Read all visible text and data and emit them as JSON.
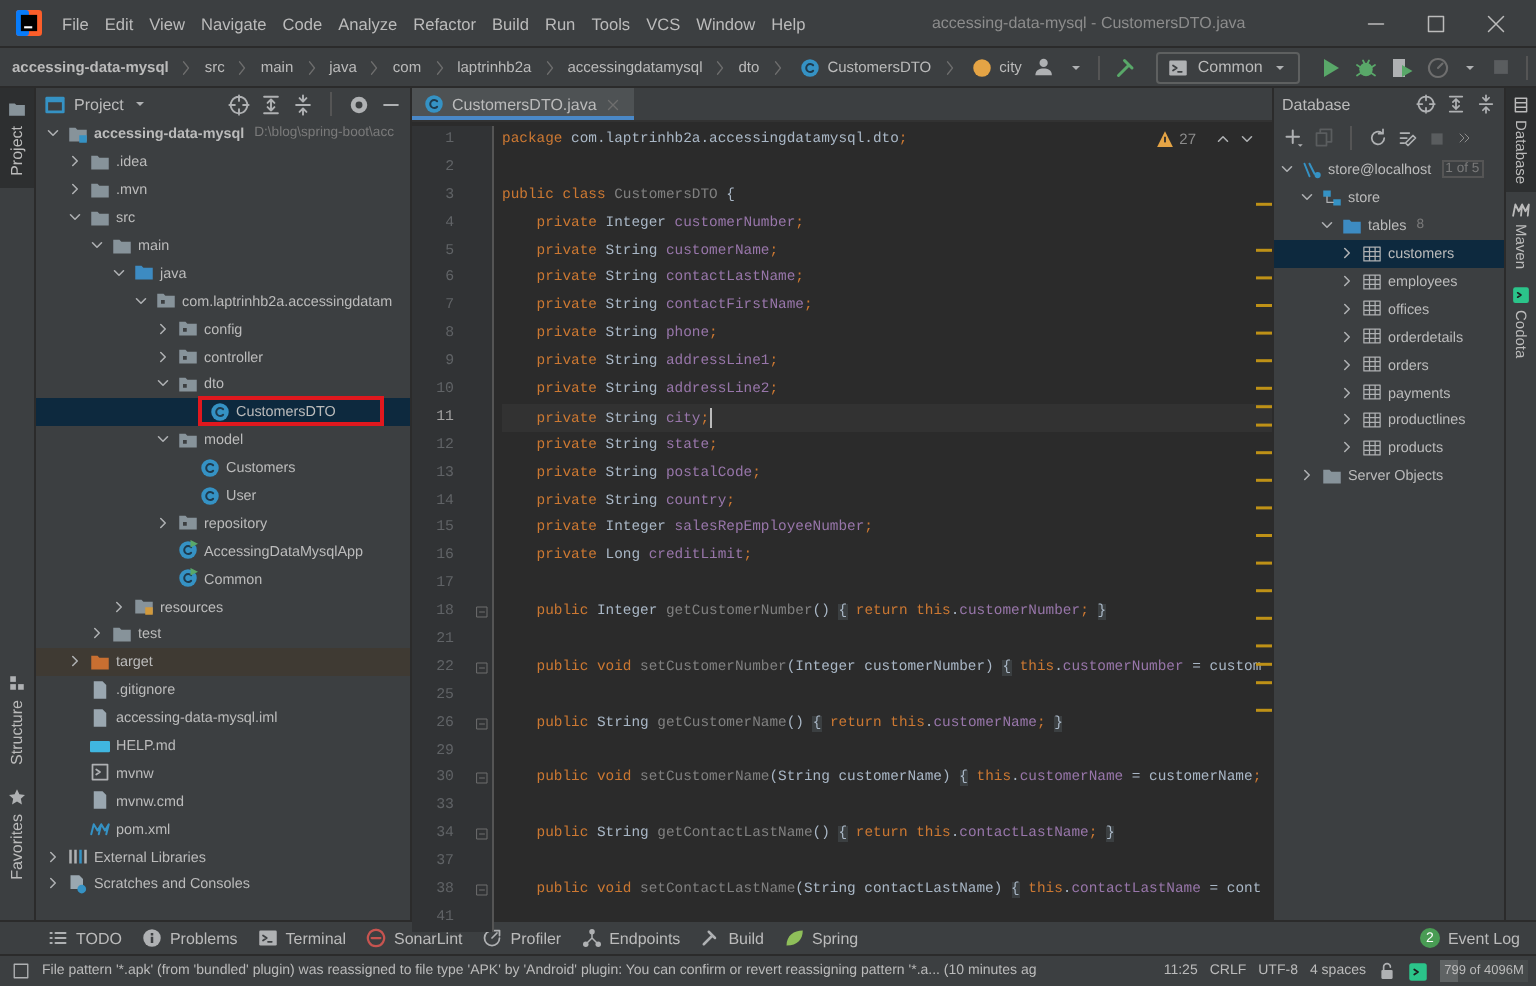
{
  "menu_bar": {
    "items": [
      "File",
      "Edit",
      "View",
      "Navigate",
      "Code",
      "Analyze",
      "Refactor",
      "Build",
      "Run",
      "Tools",
      "VCS",
      "Window",
      "Help"
    ],
    "title": "accessing-data-mysql - CustomersDTO.java"
  },
  "breadcrumbs": [
    {
      "label": "accessing-data-mysql",
      "kind": "project"
    },
    {
      "label": "src",
      "kind": "plain"
    },
    {
      "label": "main",
      "kind": "plain"
    },
    {
      "label": "java",
      "kind": "plain"
    },
    {
      "label": "com",
      "kind": "plain"
    },
    {
      "label": "laptrinhb2a",
      "kind": "plain"
    },
    {
      "label": "accessingdatamysql",
      "kind": "plain"
    },
    {
      "label": "dto",
      "kind": "plain"
    },
    {
      "label": "CustomersDTO",
      "kind": "class"
    },
    {
      "label": "city",
      "kind": "field"
    }
  ],
  "run_config": {
    "label": "Common"
  },
  "project_panel": {
    "title": "Project",
    "tree": [
      {
        "label": "accessing-data-mysql",
        "kind": "module",
        "note": "D:\\blog\\spring-boot\\acc",
        "expanded": true,
        "selected": false,
        "annotated": false,
        "children": [
          {
            "label": ".idea",
            "kind": "folder",
            "expanded": false,
            "selected": false,
            "annotated": false
          },
          {
            "label": ".mvn",
            "kind": "folder",
            "expanded": false,
            "selected": false,
            "annotated": false
          },
          {
            "label": "src",
            "kind": "folder",
            "expanded": true,
            "selected": false,
            "annotated": false,
            "children": [
              {
                "label": "main",
                "kind": "folder",
                "expanded": true,
                "selected": false,
                "annotated": false,
                "children": [
                  {
                    "label": "java",
                    "kind": "source",
                    "expanded": true,
                    "selected": false,
                    "annotated": false,
                    "children": [
                      {
                        "label": "com.laptrinhb2a.accessingdatam",
                        "kind": "package",
                        "expanded": true,
                        "selected": false,
                        "annotated": false,
                        "children": [
                          {
                            "label": "config",
                            "kind": "package",
                            "expanded": false,
                            "selected": false,
                            "annotated": false
                          },
                          {
                            "label": "controller",
                            "kind": "package",
                            "expanded": false,
                            "selected": false,
                            "annotated": false
                          },
                          {
                            "label": "dto",
                            "kind": "package",
                            "expanded": true,
                            "selected": false,
                            "annotated": false,
                            "children": [
                              {
                                "label": "CustomersDTO",
                                "kind": "class",
                                "selected": true,
                                "annotated": true
                              }
                            ]
                          },
                          {
                            "label": "model",
                            "kind": "package",
                            "expanded": true,
                            "selected": false,
                            "annotated": false,
                            "children": [
                              {
                                "label": "Customers",
                                "kind": "class",
                                "selected": false,
                                "annotated": false
                              },
                              {
                                "label": "User",
                                "kind": "class",
                                "selected": false,
                                "annotated": false
                              }
                            ]
                          },
                          {
                            "label": "repository",
                            "kind": "package",
                            "expanded": false,
                            "selected": false,
                            "annotated": false
                          },
                          {
                            "label": "AccessingDataMysqlApp",
                            "kind": "runnable",
                            "selected": false,
                            "annotated": false
                          },
                          {
                            "label": "Common",
                            "kind": "runnable",
                            "selected": false,
                            "annotated": false
                          }
                        ]
                      }
                    ]
                  },
                  {
                    "label": "resources",
                    "kind": "resources",
                    "expanded": false,
                    "selected": false,
                    "annotated": false
                  }
                ]
              },
              {
                "label": "test",
                "kind": "folder",
                "expanded": false,
                "selected": false,
                "annotated": false
              }
            ]
          },
          {
            "label": "target",
            "kind": "excluded",
            "expanded": false,
            "selected": false,
            "annotated": false
          },
          {
            "label": ".gitignore",
            "kind": "file",
            "selected": false,
            "annotated": false
          },
          {
            "label": "accessing-data-mysql.iml",
            "kind": "file",
            "selected": false,
            "annotated": false
          },
          {
            "label": "HELP.md",
            "kind": "markdown",
            "selected": false,
            "annotated": false
          },
          {
            "label": "mvnw",
            "kind": "script",
            "selected": false,
            "annotated": false
          },
          {
            "label": "mvnw.cmd",
            "kind": "file",
            "selected": false,
            "annotated": false
          },
          {
            "label": "pom.xml",
            "kind": "pom",
            "selected": false,
            "annotated": false
          }
        ]
      },
      {
        "label": "External Libraries",
        "kind": "libraries",
        "expanded": false,
        "selected": false,
        "annotated": false
      },
      {
        "label": "Scratches and Consoles",
        "kind": "scratches",
        "expanded": false,
        "selected": false,
        "annotated": false
      }
    ]
  },
  "editor": {
    "tab": {
      "label": "CustomersDTO.java",
      "selected": true
    },
    "warnings": "27",
    "lines": [
      {
        "number": "1",
        "current": false,
        "foldable": false,
        "tokens": [
          {
            "kind": "keyword",
            "text": "package "
          },
          {
            "kind": "plain",
            "text": "com.laptrinhb2a.accessingdatamysql.dto"
          },
          {
            "kind": "keyword",
            "text": ";"
          }
        ]
      },
      {
        "number": "2",
        "current": false,
        "foldable": false
      },
      {
        "number": "3",
        "current": false,
        "foldable": false,
        "tokens": [
          {
            "kind": "keyword",
            "text": "public class "
          },
          {
            "kind": "unused",
            "text": "CustomersDTO"
          },
          {
            "kind": "plain",
            "text": " {"
          }
        ]
      },
      {
        "number": "4",
        "current": false,
        "foldable": false,
        "tokens": [
          {
            "kind": "keyword",
            "text": "    private "
          },
          {
            "kind": "plain",
            "text": "Integer "
          },
          {
            "kind": "field",
            "text": "customerNumber"
          },
          {
            "kind": "keyword",
            "text": ";"
          }
        ]
      },
      {
        "number": "5",
        "current": false,
        "foldable": false,
        "tokens": [
          {
            "kind": "keyword",
            "text": "    private "
          },
          {
            "kind": "plain",
            "text": "String "
          },
          {
            "kind": "field",
            "text": "customerName"
          },
          {
            "kind": "keyword",
            "text": ";"
          }
        ]
      },
      {
        "number": "6",
        "current": false,
        "foldable": false,
        "tokens": [
          {
            "kind": "keyword",
            "text": "    private "
          },
          {
            "kind": "plain",
            "text": "String "
          },
          {
            "kind": "field",
            "text": "contactLastName"
          },
          {
            "kind": "keyword",
            "text": ";"
          }
        ]
      },
      {
        "number": "7",
        "current": false,
        "foldable": false,
        "tokens": [
          {
            "kind": "keyword",
            "text": "    private "
          },
          {
            "kind": "plain",
            "text": "String "
          },
          {
            "kind": "field",
            "text": "contactFirstName"
          },
          {
            "kind": "keyword",
            "text": ";"
          }
        ]
      },
      {
        "number": "8",
        "current": false,
        "foldable": false,
        "tokens": [
          {
            "kind": "keyword",
            "text": "    private "
          },
          {
            "kind": "plain",
            "text": "String "
          },
          {
            "kind": "field",
            "text": "phone"
          },
          {
            "kind": "keyword",
            "text": ";"
          }
        ]
      },
      {
        "number": "9",
        "current": false,
        "foldable": false,
        "tokens": [
          {
            "kind": "keyword",
            "text": "    private "
          },
          {
            "kind": "plain",
            "text": "String "
          },
          {
            "kind": "field",
            "text": "addressLine1"
          },
          {
            "kind": "keyword",
            "text": ";"
          }
        ]
      },
      {
        "number": "10",
        "current": false,
        "foldable": false,
        "tokens": [
          {
            "kind": "keyword",
            "text": "    private "
          },
          {
            "kind": "plain",
            "text": "String "
          },
          {
            "kind": "field",
            "text": "addressLine2"
          },
          {
            "kind": "keyword",
            "text": ";"
          }
        ]
      },
      {
        "number": "11",
        "current": true,
        "foldable": false,
        "tokens": [
          {
            "kind": "keyword",
            "text": "    private "
          },
          {
            "kind": "plain",
            "text": "String "
          },
          {
            "kind": "field",
            "text": "city"
          },
          {
            "kind": "keyword",
            "text": ";"
          }
        ]
      },
      {
        "number": "12",
        "current": false,
        "foldable": false,
        "tokens": [
          {
            "kind": "keyword",
            "text": "    private "
          },
          {
            "kind": "plain",
            "text": "String "
          },
          {
            "kind": "field",
            "text": "state"
          },
          {
            "kind": "keyword",
            "text": ";"
          }
        ]
      },
      {
        "number": "13",
        "current": false,
        "foldable": false,
        "tokens": [
          {
            "kind": "keyword",
            "text": "    private "
          },
          {
            "kind": "plain",
            "text": "String "
          },
          {
            "kind": "field",
            "text": "postalCode"
          },
          {
            "kind": "keyword",
            "text": ";"
          }
        ]
      },
      {
        "number": "14",
        "current": false,
        "foldable": false,
        "tokens": [
          {
            "kind": "keyword",
            "text": "    private "
          },
          {
            "kind": "plain",
            "text": "String "
          },
          {
            "kind": "field",
            "text": "country"
          },
          {
            "kind": "keyword",
            "text": ";"
          }
        ]
      },
      {
        "number": "15",
        "current": false,
        "foldable": false,
        "tokens": [
          {
            "kind": "keyword",
            "text": "    private "
          },
          {
            "kind": "plain",
            "text": "Integer "
          },
          {
            "kind": "field",
            "text": "salesRepEmployeeNumber"
          },
          {
            "kind": "keyword",
            "text": ";"
          }
        ]
      },
      {
        "number": "16",
        "current": false,
        "foldable": false,
        "tokens": [
          {
            "kind": "keyword",
            "text": "    private "
          },
          {
            "kind": "plain",
            "text": "Long "
          },
          {
            "kind": "field",
            "text": "creditLimit"
          },
          {
            "kind": "keyword",
            "text": ";"
          }
        ]
      },
      {
        "number": "17",
        "current": false,
        "foldable": false
      },
      {
        "number": "18",
        "current": false,
        "foldable": true,
        "tokens": [
          {
            "kind": "keyword",
            "text": "    public "
          },
          {
            "kind": "plain",
            "text": "Integer "
          },
          {
            "kind": "unused",
            "text": "getCustomerNumber"
          },
          {
            "kind": "plain",
            "text": "() "
          },
          {
            "kind": "fold",
            "text": "{"
          },
          {
            "kind": "keyword",
            "text": " return this"
          },
          {
            "kind": "plain",
            "text": "."
          },
          {
            "kind": "field",
            "text": "customerNumber"
          },
          {
            "kind": "keyword",
            "text": "; "
          },
          {
            "kind": "fold",
            "text": "}"
          }
        ]
      },
      {
        "number": "21",
        "current": false,
        "foldable": false
      },
      {
        "number": "22",
        "current": false,
        "foldable": true,
        "tokens": [
          {
            "kind": "keyword",
            "text": "    public void "
          },
          {
            "kind": "unused",
            "text": "setCustomerNumber"
          },
          {
            "kind": "plain",
            "text": "(Integer customerNumber) "
          },
          {
            "kind": "fold",
            "text": "{"
          },
          {
            "kind": "keyword",
            "text": " this"
          },
          {
            "kind": "plain",
            "text": "."
          },
          {
            "kind": "field",
            "text": "customerNumber"
          },
          {
            "kind": "plain",
            "text": " = custom"
          }
        ]
      },
      {
        "number": "25",
        "current": false,
        "foldable": false
      },
      {
        "number": "26",
        "current": false,
        "foldable": true,
        "tokens": [
          {
            "kind": "keyword",
            "text": "    public "
          },
          {
            "kind": "plain",
            "text": "String "
          },
          {
            "kind": "unused",
            "text": "getCustomerName"
          },
          {
            "kind": "plain",
            "text": "() "
          },
          {
            "kind": "fold",
            "text": "{"
          },
          {
            "kind": "keyword",
            "text": " return this"
          },
          {
            "kind": "plain",
            "text": "."
          },
          {
            "kind": "field",
            "text": "customerName"
          },
          {
            "kind": "keyword",
            "text": "; "
          },
          {
            "kind": "fold",
            "text": "}"
          }
        ]
      },
      {
        "number": "29",
        "current": false,
        "foldable": false
      },
      {
        "number": "30",
        "current": false,
        "foldable": true,
        "tokens": [
          {
            "kind": "keyword",
            "text": "    public void "
          },
          {
            "kind": "unused",
            "text": "setCustomerName"
          },
          {
            "kind": "plain",
            "text": "(String customerName) "
          },
          {
            "kind": "fold",
            "text": "{"
          },
          {
            "kind": "keyword",
            "text": " this"
          },
          {
            "kind": "plain",
            "text": "."
          },
          {
            "kind": "field",
            "text": "customerName"
          },
          {
            "kind": "plain",
            "text": " = customerName"
          },
          {
            "kind": "keyword",
            "text": ";"
          }
        ]
      },
      {
        "number": "33",
        "current": false,
        "foldable": false
      },
      {
        "number": "34",
        "current": false,
        "foldable": true,
        "tokens": [
          {
            "kind": "keyword",
            "text": "    public "
          },
          {
            "kind": "plain",
            "text": "String "
          },
          {
            "kind": "unused",
            "text": "getContactLastName"
          },
          {
            "kind": "plain",
            "text": "() "
          },
          {
            "kind": "fold",
            "text": "{"
          },
          {
            "kind": "keyword",
            "text": " return this"
          },
          {
            "kind": "plain",
            "text": "."
          },
          {
            "kind": "field",
            "text": "contactLastName"
          },
          {
            "kind": "keyword",
            "text": "; "
          },
          {
            "kind": "fold",
            "text": "}"
          }
        ]
      },
      {
        "number": "37",
        "current": false,
        "foldable": false
      },
      {
        "number": "38",
        "current": false,
        "foldable": true,
        "tokens": [
          {
            "kind": "keyword",
            "text": "    public void "
          },
          {
            "kind": "unused",
            "text": "setContactLastName"
          },
          {
            "kind": "plain",
            "text": "(String contactLastName) "
          },
          {
            "kind": "fold",
            "text": "{"
          },
          {
            "kind": "keyword",
            "text": " this"
          },
          {
            "kind": "plain",
            "text": "."
          },
          {
            "kind": "field",
            "text": "contactLastName"
          },
          {
            "kind": "plain",
            "text": " = cont"
          }
        ]
      },
      {
        "number": "41",
        "current": false,
        "foldable": false
      }
    ]
  },
  "database_panel": {
    "title": "Database",
    "tree": [
      {
        "label": "store@localhost",
        "kind": "connection",
        "note": "1 of 5",
        "expanded": true,
        "selected": false,
        "children": [
          {
            "label": "store",
            "kind": "schema",
            "expanded": true,
            "selected": false,
            "children": [
              {
                "label": "tables",
                "kind": "source",
                "note": "8",
                "expanded": true,
                "selected": false,
                "children": [
                  {
                    "label": "customers",
                    "kind": "table",
                    "expanded": false,
                    "selected": true
                  },
                  {
                    "label": "employees",
                    "kind": "table",
                    "expanded": false,
                    "selected": false
                  },
                  {
                    "label": "offices",
                    "kind": "table",
                    "expanded": false,
                    "selected": false
                  },
                  {
                    "label": "orderdetails",
                    "kind": "table",
                    "expanded": false,
                    "selected": false
                  },
                  {
                    "label": "orders",
                    "kind": "table",
                    "expanded": false,
                    "selected": false
                  },
                  {
                    "label": "payments",
                    "kind": "table",
                    "expanded": false,
                    "selected": false
                  },
                  {
                    "label": "productlines",
                    "kind": "table",
                    "expanded": false,
                    "selected": false
                  },
                  {
                    "label": "products",
                    "kind": "table",
                    "expanded": false,
                    "selected": false
                  }
                ]
              }
            ]
          },
          {
            "label": "Server Objects",
            "kind": "folder",
            "expanded": false,
            "selected": false
          }
        ]
      }
    ]
  },
  "left_stripe": {
    "top": [
      {
        "label": "Project",
        "kind": "folder",
        "selected": true
      }
    ],
    "bottom": [
      {
        "label": "Structure",
        "kind": "structure",
        "selected": false
      },
      {
        "label": "Favorites",
        "kind": "star",
        "selected": false
      }
    ]
  },
  "right_stripe": [
    {
      "label": "Database",
      "kind": "database",
      "selected": true
    },
    {
      "label": "Maven",
      "kind": "maven",
      "selected": false
    },
    {
      "label": "Codota",
      "kind": "codota",
      "selected": false
    }
  ],
  "tool_windows": [
    {
      "label": "TODO",
      "kind": "list"
    },
    {
      "label": "Problems",
      "kind": "info"
    },
    {
      "label": "Terminal",
      "kind": "terminal"
    },
    {
      "label": "SonarLint",
      "kind": "sonar"
    },
    {
      "label": "Profiler",
      "kind": "profiler"
    },
    {
      "label": "Endpoints",
      "kind": "endpoints"
    },
    {
      "label": "Build",
      "kind": "build"
    },
    {
      "label": "Spring",
      "kind": "spring"
    }
  ],
  "event_log": {
    "count": "2",
    "label": "Event Log"
  },
  "status_bar": {
    "message": "File pattern '*.apk' (from 'bundled' plugin) was reassigned to file type 'APK' by 'Android' plugin: You can confirm or revert reassigning pattern '*.a... (10 minutes ag",
    "items": [
      "11:25",
      "CRLF",
      "UTF-8",
      "4 spaces"
    ],
    "memory": {
      "text": "799 of 4096M",
      "level": 0.2
    }
  }
}
